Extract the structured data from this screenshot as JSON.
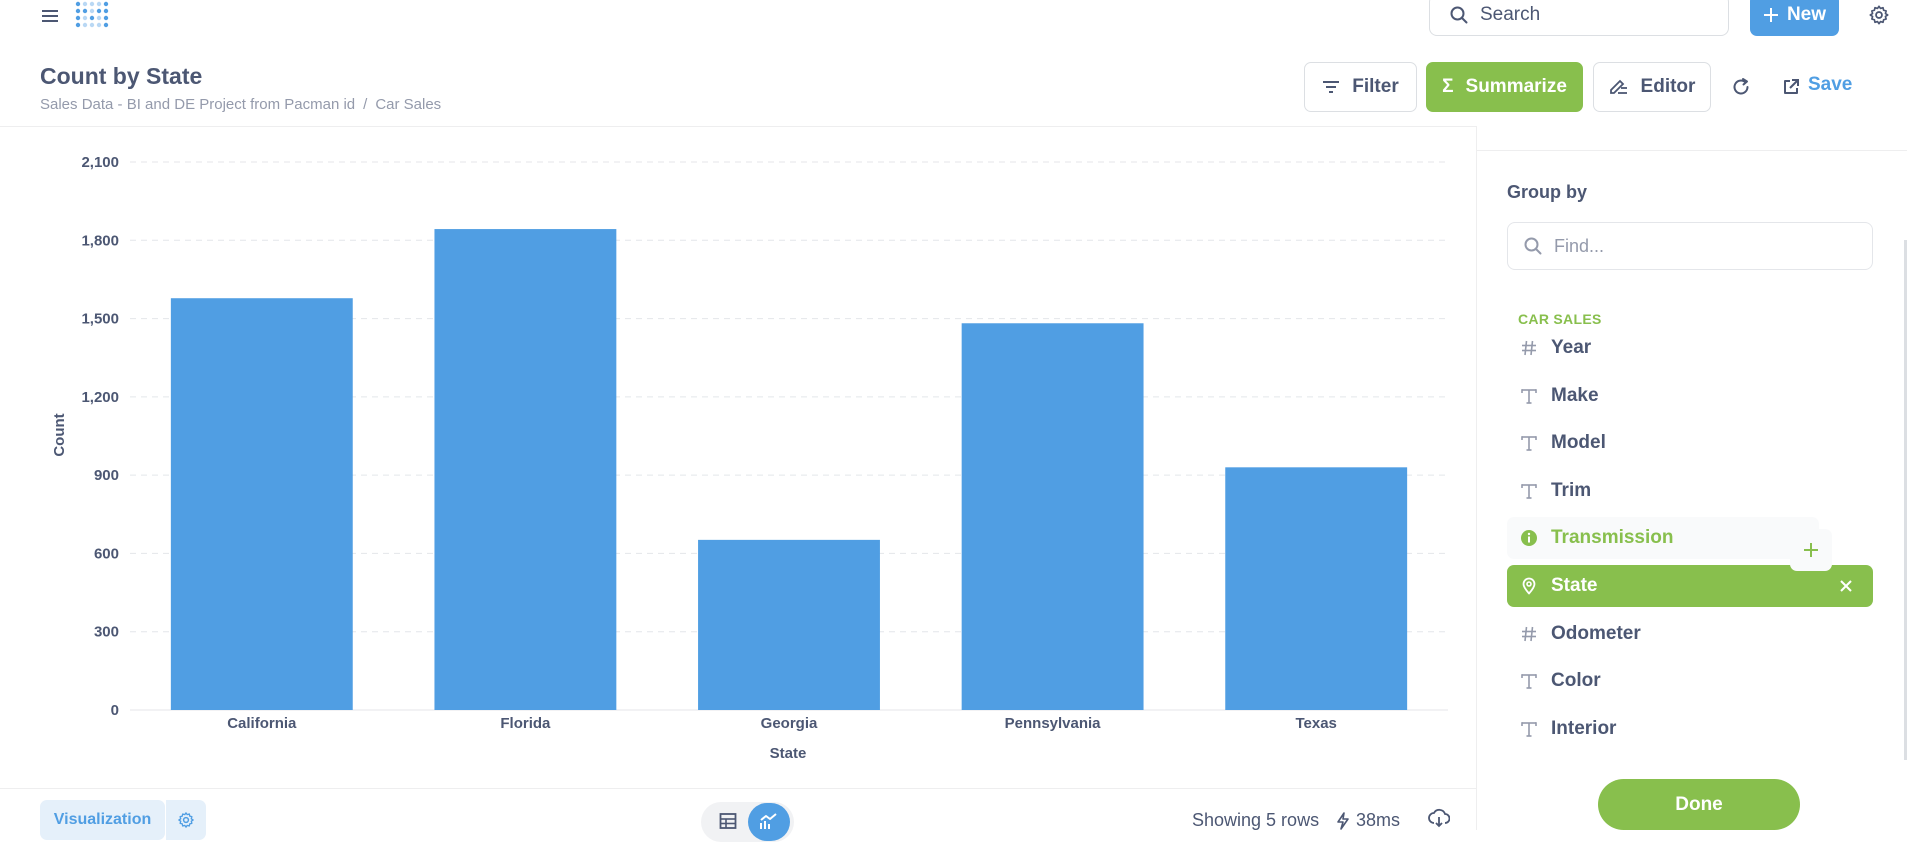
{
  "nav": {
    "search_label": "Search",
    "new_label": "New"
  },
  "header": {
    "title": "Count by State",
    "breadcrumb": [
      "Sales Data - BI and DE Project from Pacman id",
      "/",
      "Car Sales"
    ],
    "filter_label": "Filter",
    "summarize_label": "Summarize",
    "editor_label": "Editor",
    "save_label": "Save"
  },
  "sidebar": {
    "title": "Group by",
    "find_placeholder": "Find...",
    "section": "CAR SALES",
    "columns": [
      {
        "label": "Year",
        "icon": "number-icon"
      },
      {
        "label": "Make",
        "icon": "text-icon"
      },
      {
        "label": "Model",
        "icon": "text-icon"
      },
      {
        "label": "Trim",
        "icon": "text-icon"
      },
      {
        "label": "Transmission",
        "icon": "info-icon",
        "state": "hover"
      },
      {
        "label": "State",
        "icon": "location-icon",
        "state": "selected"
      },
      {
        "label": "Odometer",
        "icon": "number-icon"
      },
      {
        "label": "Color",
        "icon": "text-icon"
      },
      {
        "label": "Interior",
        "icon": "text-icon"
      }
    ],
    "done_label": "Done"
  },
  "chart_data": {
    "type": "bar",
    "categories": [
      "California",
      "Florida",
      "Georgia",
      "Pennsylvania",
      "Texas"
    ],
    "values": [
      1578,
      1843,
      652,
      1482,
      930
    ],
    "xlabel": "State",
    "ylabel": "Count",
    "ylim": [
      0,
      2100
    ],
    "yticks": [
      "0",
      "300",
      "600",
      "900",
      "1,200",
      "1,500",
      "1,800",
      "2,100"
    ],
    "grid": true,
    "bar_color": "#509ee3"
  },
  "footer": {
    "visualization_label": "Visualization",
    "row_count": "Showing 5 rows",
    "timing": "38ms"
  },
  "colors": {
    "brand": "#509ee3",
    "accent": "#88bf4d"
  }
}
